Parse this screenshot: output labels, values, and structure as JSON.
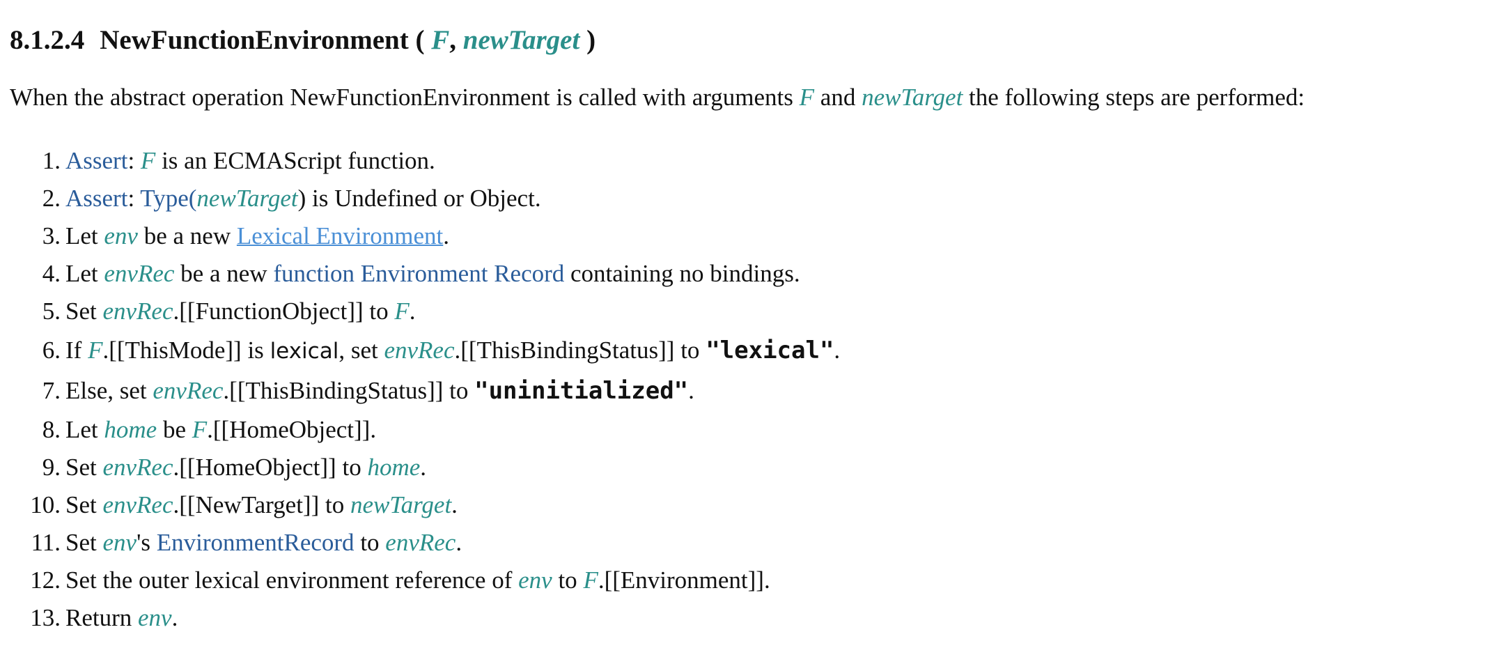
{
  "heading": {
    "number": "8.1.2.4",
    "name": "NewFunctionEnvironment",
    "open_paren": " ( ",
    "param1": "F",
    "comma": ", ",
    "param2": "newTarget",
    "close_paren": " )"
  },
  "intro": {
    "t1": "When the abstract operation NewFunctionEnvironment is called with arguments ",
    "v1": "F",
    "t2": " and ",
    "v2": "newTarget",
    "t3": " the following steps are performed:"
  },
  "steps": [
    {
      "num": "1.",
      "parts": [
        "Assert",
        ": ",
        "F",
        " is an ECMAScript function."
      ]
    },
    {
      "num": "2.",
      "parts": [
        "Assert",
        ": ",
        "Type",
        "(",
        "newTarget",
        ") is Undefined or Object."
      ]
    },
    {
      "num": "3.",
      "parts": [
        "Let ",
        "env",
        " be a new ",
        "Lexical Environment",
        "."
      ]
    },
    {
      "num": "4.",
      "parts": [
        "Let ",
        "envRec",
        " be a new ",
        "function Environment Record",
        " containing no bindings."
      ]
    },
    {
      "num": "5.",
      "parts": [
        "Set ",
        "envRec",
        ".[[FunctionObject]] to ",
        "F",
        "."
      ]
    },
    {
      "num": "6.",
      "parts": [
        "If ",
        "F",
        ".[[ThisMode]] is ",
        "lexical",
        ", set ",
        "envRec",
        ".[[ThisBindingStatus]] to ",
        "\"lexical\"",
        "."
      ]
    },
    {
      "num": "7.",
      "parts": [
        "Else, set ",
        "envRec",
        ".[[ThisBindingStatus]] to ",
        "\"uninitialized\"",
        "."
      ]
    },
    {
      "num": "8.",
      "parts": [
        "Let ",
        "home",
        " be ",
        "F",
        ".[[HomeObject]]."
      ]
    },
    {
      "num": "9.",
      "parts": [
        "Set ",
        "envRec",
        ".[[HomeObject]] to ",
        "home",
        "."
      ]
    },
    {
      "num": "10.",
      "parts": [
        "Set ",
        "envRec",
        ".[[NewTarget]] to ",
        "newTarget",
        "."
      ]
    },
    {
      "num": "11.",
      "parts": [
        "Set ",
        "env",
        "'s ",
        "EnvironmentRecord",
        " to ",
        "envRec",
        "."
      ]
    },
    {
      "num": "12.",
      "parts": [
        "Set the outer lexical environment reference of ",
        "env",
        " to ",
        "F",
        ".[[Environment]]."
      ]
    },
    {
      "num": "13.",
      "parts": [
        "Return ",
        "env",
        "."
      ]
    }
  ],
  "colors": {
    "variable": "#2a8f8a",
    "xref": "#2a5c9a",
    "link": "#4a8fd6"
  }
}
